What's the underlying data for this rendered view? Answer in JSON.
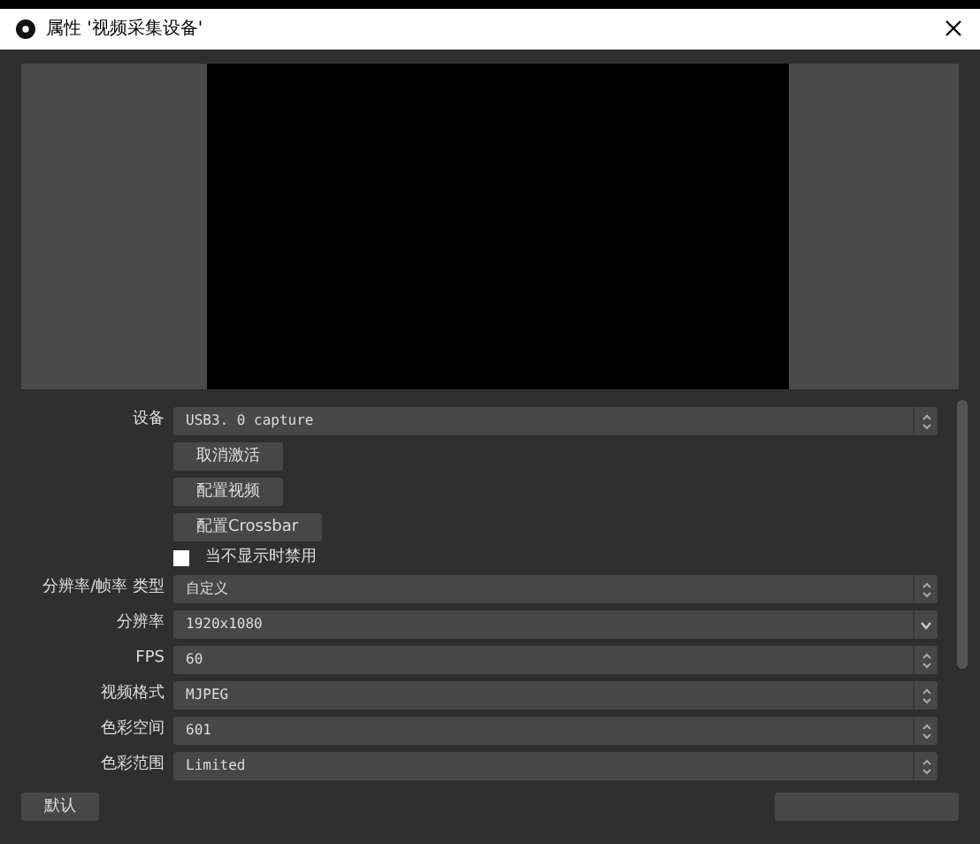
{
  "window": {
    "title": "属性 '视频采集设备'"
  },
  "rows": [
    {
      "kind": "select",
      "label": "设备",
      "value": "USB3. 0 capture"
    },
    {
      "kind": "button",
      "text": "取消激活"
    },
    {
      "kind": "button",
      "text": "配置视频"
    },
    {
      "kind": "button",
      "text": "配置Crossbar"
    },
    {
      "kind": "checkbox",
      "text": "当不显示时禁用",
      "checked": false
    },
    {
      "kind": "select",
      "label": "分辨率/帧率 类型",
      "value": "自定义"
    },
    {
      "kind": "combo",
      "label": "分辨率",
      "value": "1920x1080"
    },
    {
      "kind": "select",
      "label": "FPS",
      "value": "60"
    },
    {
      "kind": "select",
      "label": "视频格式",
      "value": "MJPEG"
    },
    {
      "kind": "select",
      "label": "色彩空间",
      "value": "601"
    },
    {
      "kind": "select",
      "label": "色彩范围",
      "value": "Limited"
    }
  ],
  "footer": {
    "defaults_button": "默认"
  }
}
